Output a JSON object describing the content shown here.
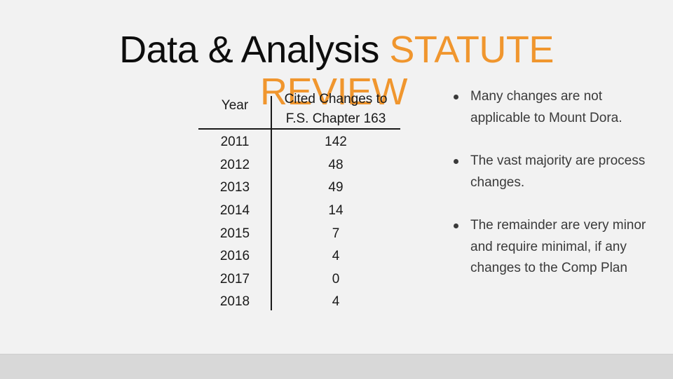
{
  "title": {
    "plain": "Data & Analysis ",
    "accent_line1": "STATUTE",
    "accent_line2": "REVIEW"
  },
  "colors": {
    "accent": "#f0962e",
    "text": "#0d0d0d",
    "body_text": "#3a3a3a",
    "background": "#f2f2f2",
    "footer_band": "#d8d8d8"
  },
  "table": {
    "headers": {
      "year": "Year",
      "changes_line1": "Cited Changes to",
      "changes_line2": "F.S. Chapter 163"
    },
    "rows": [
      {
        "year": "2011",
        "count": "142"
      },
      {
        "year": "2012",
        "count": "48"
      },
      {
        "year": "2013",
        "count": "49"
      },
      {
        "year": "2014",
        "count": "14"
      },
      {
        "year": "2015",
        "count": "7"
      },
      {
        "year": "2016",
        "count": "4"
      },
      {
        "year": "2017",
        "count": "0"
      },
      {
        "year": "2018",
        "count": "4"
      }
    ]
  },
  "bullets": [
    "Many changes are not applicable to Mount Dora.",
    "The vast majority are process changes.",
    "The remainder are very minor and require minimal, if any changes to the Comp Plan"
  ]
}
